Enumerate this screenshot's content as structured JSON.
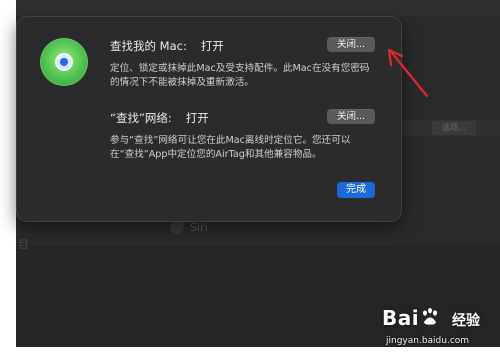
{
  "background": {
    "siri_label": "Siri",
    "side_char": "目",
    "tag_label": "选项..."
  },
  "dialog": {
    "icon": "find-my-icon",
    "find_my_mac": {
      "title": "查找我的 Mac:",
      "state": "打开",
      "button": "关闭...",
      "description": "定位、锁定或抹掉此Mac及受支持配件。此Mac在没有您密码的情况下不能被抹掉及重新激活。"
    },
    "find_my_network": {
      "title": "“查找”网络:",
      "state": "打开",
      "button": "关闭...",
      "description": "参与“查找”网络可让您在此Mac离线时定位它。您还可以在“查找”App中定位您的AirTag和其他兼容物品。"
    },
    "done_button": "完成"
  },
  "annotation": {
    "color": "#e0282e",
    "icon": "red-arrow-icon"
  },
  "watermark": {
    "brand": "Bai",
    "brand_suffix": "经验",
    "url": "jingyan.baidu.com",
    "icon": "baidu-paw-icon"
  }
}
